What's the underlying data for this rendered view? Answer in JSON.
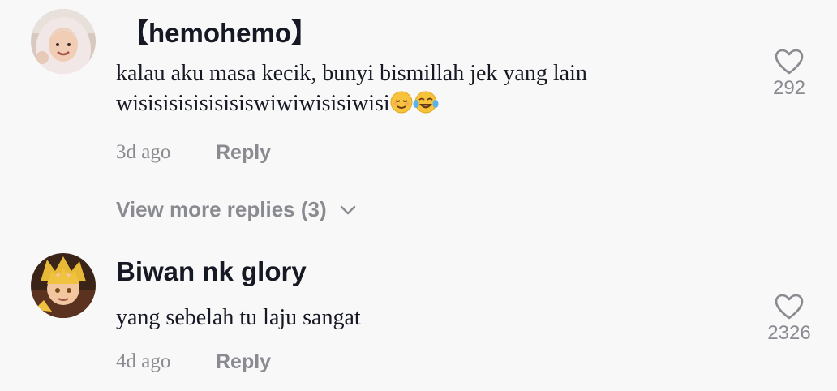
{
  "comments": [
    {
      "username": "【hemohemo】",
      "text": "kalau aku masa kecik, bunyi bismillah jek yang lain wisisisisisisisiswiwiwisisiwisi",
      "emojis": [
        "relieved-face",
        "face-with-tears-of-joy"
      ],
      "time": "3d ago",
      "reply_label": "Reply",
      "likes": "292",
      "colors": {
        "avatar_bg": "#d9c8bf",
        "hijab": "#f1e7e6",
        "skin": "#f0cdb4"
      }
    },
    {
      "username": "Biwan nk glory",
      "text": "yang sebelah tu laju sangat",
      "time": "4d ago",
      "reply_label": "Reply",
      "likes": "2326",
      "colors": {
        "avatar_bg": "#3a2418",
        "hair": "#e7b936",
        "skin": "#f2c7a0"
      }
    }
  ],
  "view_more": {
    "label": "View more replies (3)",
    "icon": "chevron-down-icon"
  },
  "icons": {
    "like": "heart-outline-icon"
  },
  "colors": {
    "background": "#f8f8f8",
    "primary_text": "#161823",
    "secondary_text": "#8a8b91"
  }
}
